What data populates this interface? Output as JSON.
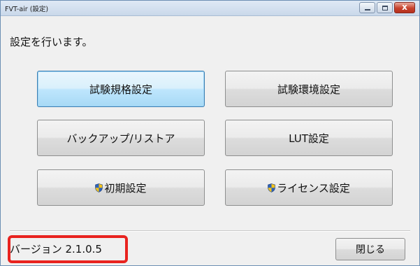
{
  "window": {
    "title": "FVT-air (設定)",
    "controls": {
      "minimize": "",
      "maximize": "",
      "close": "x"
    }
  },
  "instruction": "設定を行います。",
  "buttons": {
    "test_standard": "試験規格設定",
    "test_environment": "試験環境設定",
    "backup_restore": "バックアップ/リストア",
    "lut": "LUT設定",
    "initial_settings": "初期設定",
    "license_settings": "ライセンス設定"
  },
  "footer": {
    "version": "バージョン 2.1.0.5",
    "close": "閉じる"
  },
  "colors": {
    "highlight_box": "#e8231f",
    "focused_button": "#a7d9f5",
    "shield_blue": "#2e62b8",
    "shield_yellow": "#f2c21b"
  },
  "icons": {
    "uac_shield": "uac-shield-icon"
  }
}
